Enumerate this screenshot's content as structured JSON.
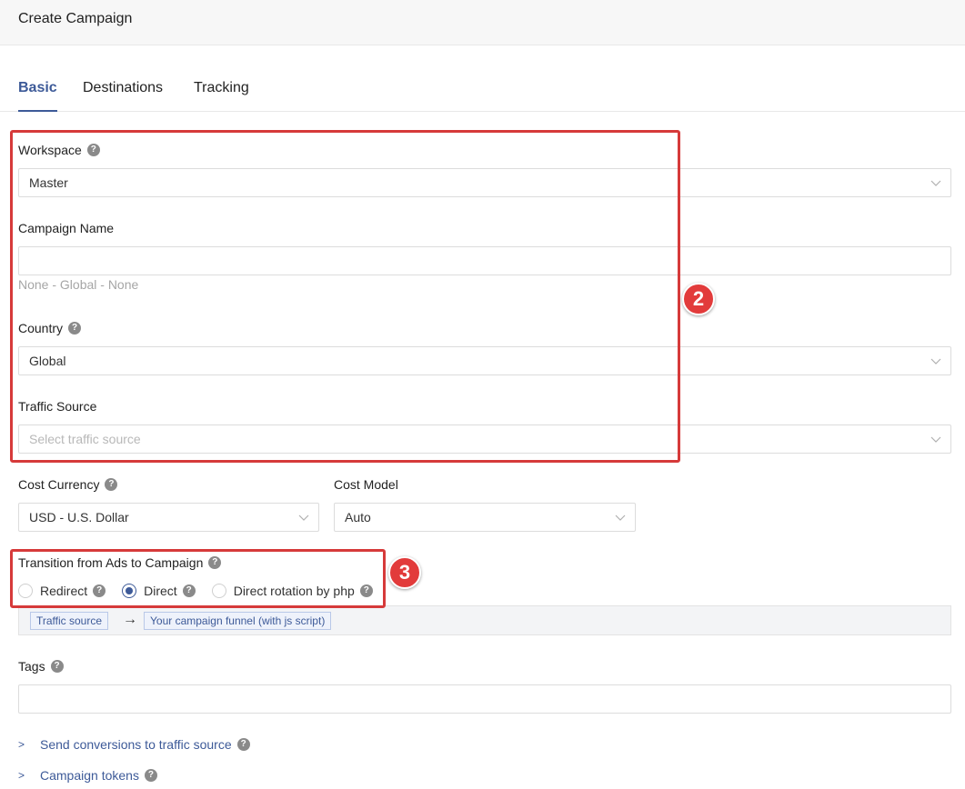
{
  "header": {
    "title": "Create Campaign"
  },
  "tabs": [
    {
      "label": "Basic",
      "active": true
    },
    {
      "label": "Destinations",
      "active": false
    },
    {
      "label": "Tracking",
      "active": false
    }
  ],
  "form": {
    "workspace": {
      "label": "Workspace",
      "value": "Master"
    },
    "campaign_name": {
      "label": "Campaign Name",
      "value": "",
      "hint": "None - Global - None"
    },
    "country": {
      "label": "Country",
      "value": "Global"
    },
    "traffic_source": {
      "label": "Traffic Source",
      "placeholder": "Select traffic source"
    },
    "cost_currency": {
      "label": "Cost Currency",
      "value": "USD - U.S. Dollar"
    },
    "cost_model": {
      "label": "Cost Model",
      "value": "Auto"
    },
    "transition": {
      "label": "Transition from Ads to Campaign",
      "options": [
        {
          "label": "Redirect",
          "checked": false
        },
        {
          "label": "Direct",
          "checked": true
        },
        {
          "label": "Direct rotation by php",
          "checked": false
        }
      ],
      "flow": {
        "from": "Traffic source",
        "to": "Your campaign funnel (with js script)"
      }
    },
    "tags": {
      "label": "Tags",
      "value": ""
    },
    "collapsibles": [
      {
        "label": "Send conversions to traffic source"
      },
      {
        "label": "Campaign tokens"
      }
    ]
  },
  "annotations": [
    {
      "number": "2"
    },
    {
      "number": "3"
    }
  ],
  "colors": {
    "accent": "#3d5a98",
    "annotation": "#e23b3b"
  },
  "icons": {
    "help": "question-circle-icon",
    "chevron": "chevron-down-icon",
    "arrow": "arrow-right-icon",
    "caret": "chevron-right-icon"
  }
}
